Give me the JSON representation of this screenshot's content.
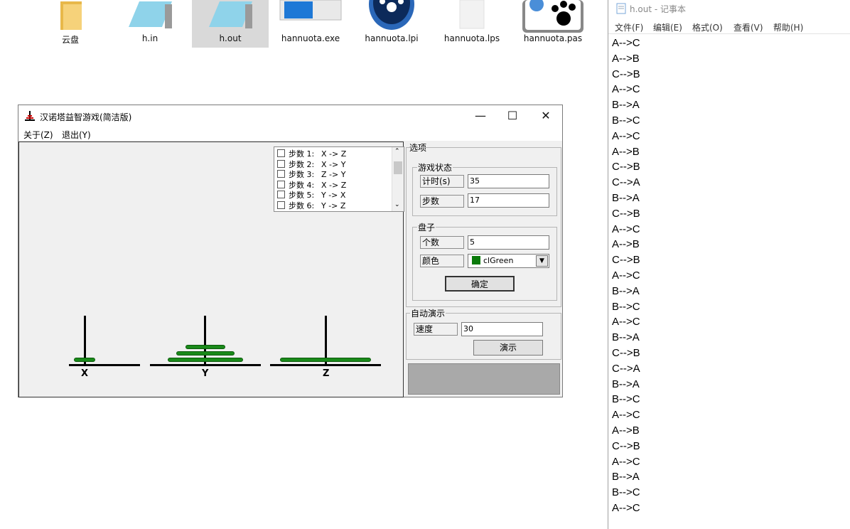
{
  "desktop": {
    "icons": [
      {
        "label": "云盘",
        "icon": "folder-icon"
      },
      {
        "label": "h.in",
        "icon": "text-file-icon"
      },
      {
        "label": "h.out",
        "icon": "text-file-icon",
        "selected": true
      },
      {
        "label": "hannuota.exe",
        "icon": "exe-file-icon"
      },
      {
        "label": "hannuota.lpi",
        "icon": "lazarus-project-icon"
      },
      {
        "label": "hannuota.lps",
        "icon": "blank-file-icon"
      },
      {
        "label": "hannuota.pas",
        "icon": "pascal-source-icon"
      }
    ]
  },
  "game": {
    "title": "汉诺塔益智游戏(简洁版)",
    "menu": {
      "about": "关于(Z)",
      "exit": "退出(Y)"
    },
    "pegs": [
      "X",
      "Y",
      "Z"
    ],
    "steps": [
      {
        "num": "步数 1:",
        "move": "X -> Z"
      },
      {
        "num": "步数 2:",
        "move": "X -> Y"
      },
      {
        "num": "步数 3:",
        "move": "Z -> Y"
      },
      {
        "num": "步数 4:",
        "move": "X -> Z"
      },
      {
        "num": "步数 5:",
        "move": "Y -> X"
      },
      {
        "num": "步数 6:",
        "move": "Y -> Z"
      }
    ],
    "options_title": "选项",
    "status_group": {
      "title": "游戏状态",
      "timer_label": "计时(s)",
      "timer_value": "35",
      "steps_label": "步数",
      "steps_value": "17"
    },
    "disk_group": {
      "title": "盘子",
      "count_label": "个数",
      "count_value": "5",
      "color_label": "颜色",
      "color_value": "clGreen",
      "confirm": "确定"
    },
    "auto_group": {
      "title": "自动演示",
      "speed_label": "速度",
      "speed_value": "30",
      "demo": "演示"
    },
    "colors": {
      "disk": "#1a8a1a"
    }
  },
  "notepad": {
    "title": "h.out - 记事本",
    "menu": [
      "文件(F)",
      "编辑(E)",
      "格式(O)",
      "查看(V)",
      "帮助(H)"
    ],
    "lines": [
      "A-->C",
      "A-->B",
      "C-->B",
      "A-->C",
      "B-->A",
      "B-->C",
      "A-->C",
      "A-->B",
      "C-->B",
      "C-->A",
      "B-->A",
      "C-->B",
      "A-->C",
      "A-->B",
      "C-->B",
      "A-->C",
      "B-->A",
      "B-->C",
      "A-->C",
      "B-->A",
      "C-->B",
      "C-->A",
      "B-->A",
      "B-->C",
      "A-->C",
      "A-->B",
      "C-->B",
      "A-->C",
      "B-->A",
      "B-->C",
      "A-->C"
    ]
  }
}
